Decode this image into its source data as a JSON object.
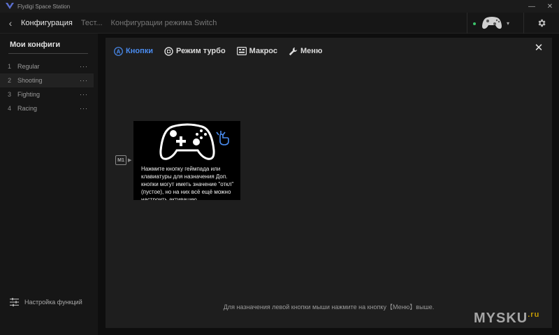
{
  "window": {
    "title": "Flydigi Space Station",
    "minimize": "—",
    "close": "✕"
  },
  "nav": {
    "back": "‹",
    "items": [
      "Конфигурация",
      "Тест...",
      "Конфигурации режима Switch"
    ]
  },
  "device": {
    "status": "online",
    "caret": "▾"
  },
  "sidebar": {
    "heading": "Мои конфиги",
    "configs": [
      {
        "num": "1",
        "name": "Regular",
        "more": "···"
      },
      {
        "num": "2",
        "name": "Shooting",
        "more": "···"
      },
      {
        "num": "3",
        "name": "Fighting",
        "more": "···"
      },
      {
        "num": "4",
        "name": "Racing",
        "more": "···"
      }
    ],
    "footer": "Настройка функций"
  },
  "panel": {
    "tabs": [
      "Кнопки",
      "Режим турбо",
      "Макрос",
      "Меню"
    ],
    "close": "✕",
    "m1_label": "M1",
    "m1_arrow": "▶",
    "popup_text": "Нажмите кнопку геймпада или клавиатуры для назначения Доп. кнопки могут иметь значение \"откл\" (пустое), но на них всё ещё можно настроить активацию",
    "hint": "Для назначения левой кнопки мыши нажмите на кнопку【Меню】выше."
  },
  "watermark": {
    "main": "MYSKU",
    "suffix": ".ru"
  },
  "colors": {
    "accent": "#4a8cf0",
    "online": "#3cc36b",
    "panel": "#1e1e1e"
  }
}
